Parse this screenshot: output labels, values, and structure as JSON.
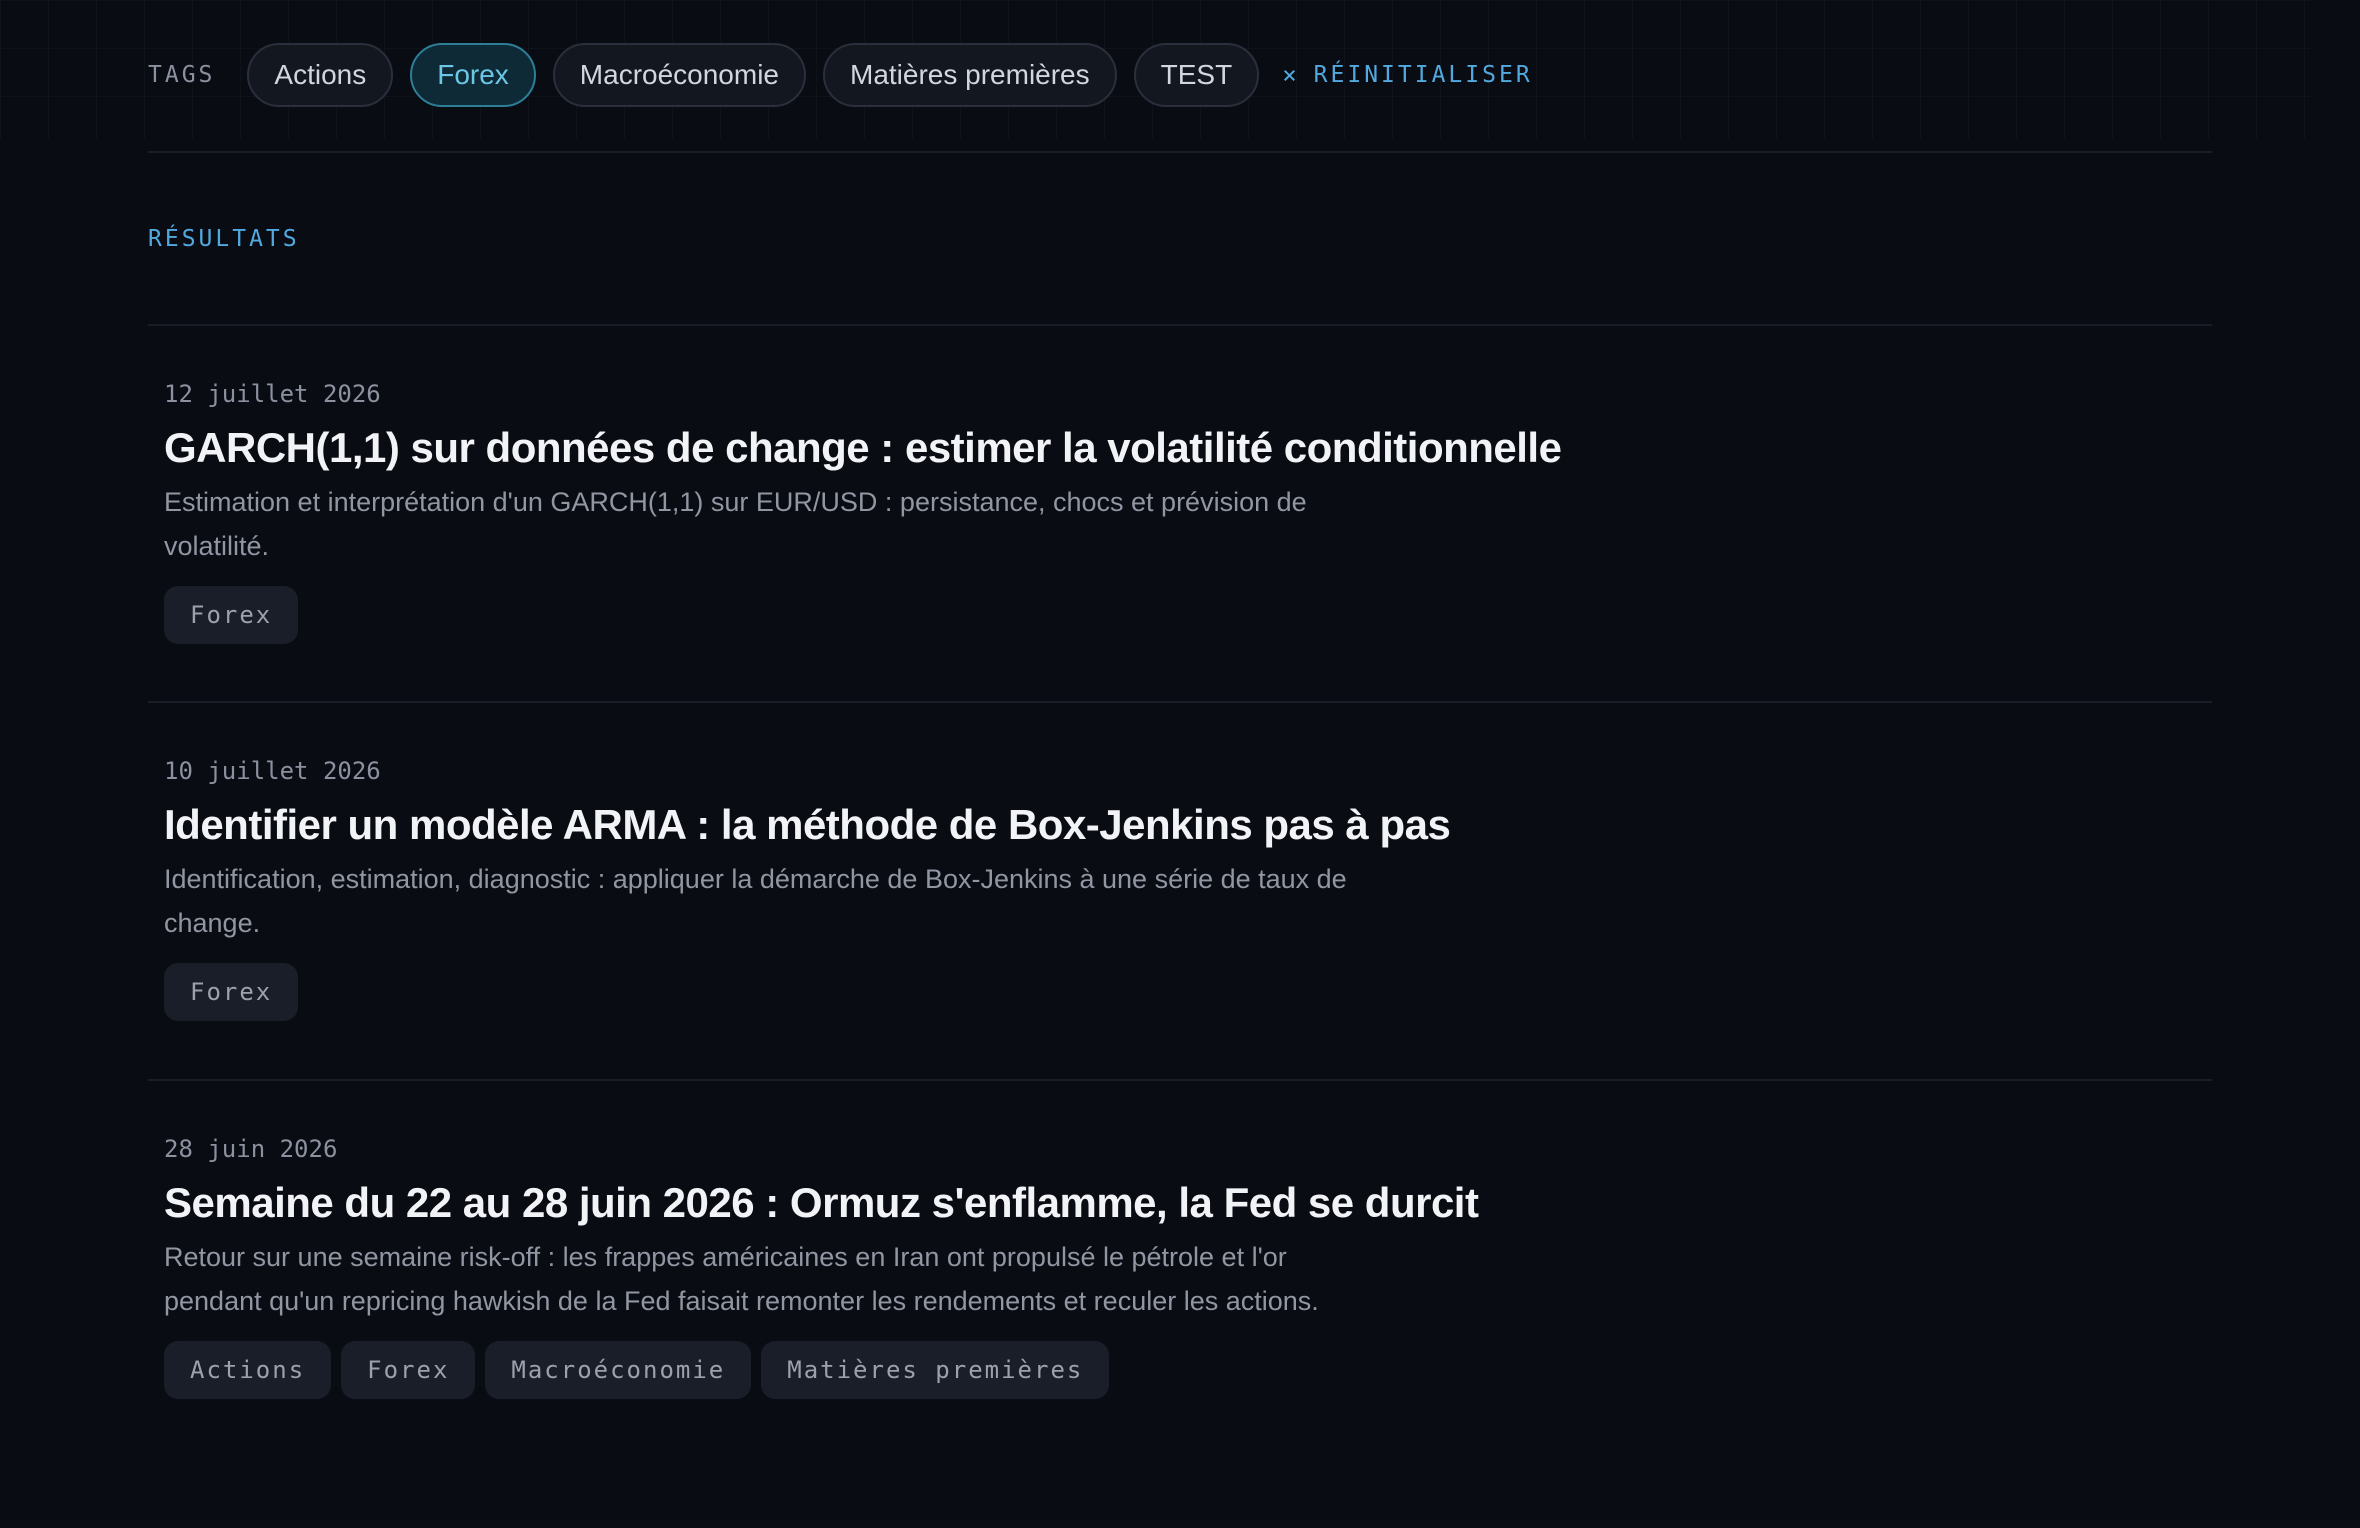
{
  "tags_bar": {
    "label": "TAGS",
    "tags": [
      {
        "label": "Actions",
        "active": false
      },
      {
        "label": "Forex",
        "active": true
      },
      {
        "label": "Macroéconomie",
        "active": false
      },
      {
        "label": "Matières premières",
        "active": false
      },
      {
        "label": "TEST",
        "active": false
      }
    ],
    "reset_icon": "×",
    "reset_label": "RÉINITIALISER"
  },
  "results": {
    "label": "RÉSULTATS",
    "articles": [
      {
        "date": "12 juillet 2026",
        "title": "GARCH(1,1) sur données de change : estimer la volatilité conditionnelle",
        "summary": "Estimation et interprétation d'un GARCH(1,1) sur EUR/USD : persistance, chocs et prévision de volatilité.",
        "tags": [
          "Forex"
        ]
      },
      {
        "date": "10 juillet 2026",
        "title": "Identifier un modèle ARMA : la méthode de Box-Jenkins pas à pas",
        "summary": "Identification, estimation, diagnostic : appliquer la démarche de Box-Jenkins à une série de taux de change.",
        "tags": [
          "Forex"
        ]
      },
      {
        "date": "28 juin 2026",
        "title": "Semaine du 22 au 28 juin 2026 : Ormuz s'enflamme, la Fed se durcit",
        "summary": "Retour sur une semaine risk-off : les frappes américaines en Iran ont propulsé le pétrole et l'or pendant qu'un repricing hawkish de la Fed faisait remonter les rendements et reculer les actions.",
        "tags": [
          "Actions",
          "Forex",
          "Macroéconomie",
          "Matières premières"
        ]
      }
    ]
  },
  "colors": {
    "background": "#0a0c13",
    "accent": "#52a9df",
    "active_tag_text": "#6cc6e6",
    "active_tag_border": "#2e7e97"
  }
}
